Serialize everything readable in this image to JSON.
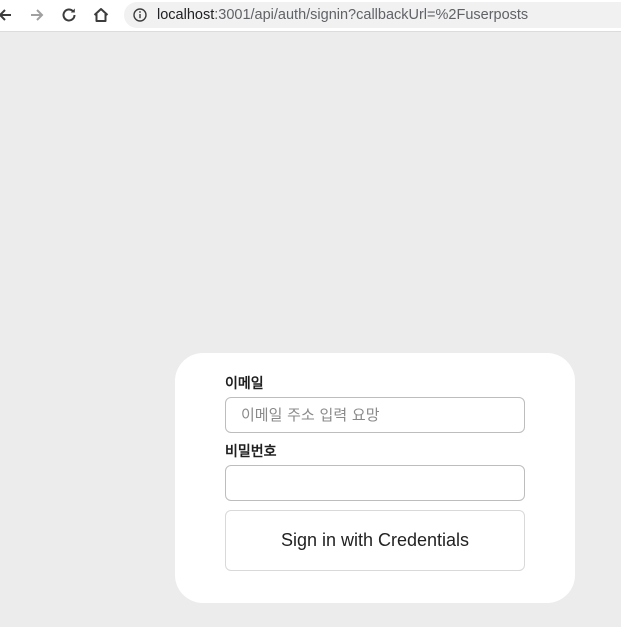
{
  "browser": {
    "url_host": "localhost",
    "url_rest": ":3001/api/auth/signin?callbackUrl=%2Fuserposts",
    "icons": [
      "back-icon",
      "forward-icon",
      "reload-icon",
      "home-icon",
      "info-icon"
    ]
  },
  "form": {
    "email_label": "이메일",
    "email_placeholder": "이메일 주소 입력 요망",
    "email_value": "",
    "password_label": "비밀번호",
    "password_value": "",
    "submit_label": "Sign in with Credentials"
  },
  "colors": {
    "page_background": "#ececec",
    "card_background": "#ffffff"
  }
}
